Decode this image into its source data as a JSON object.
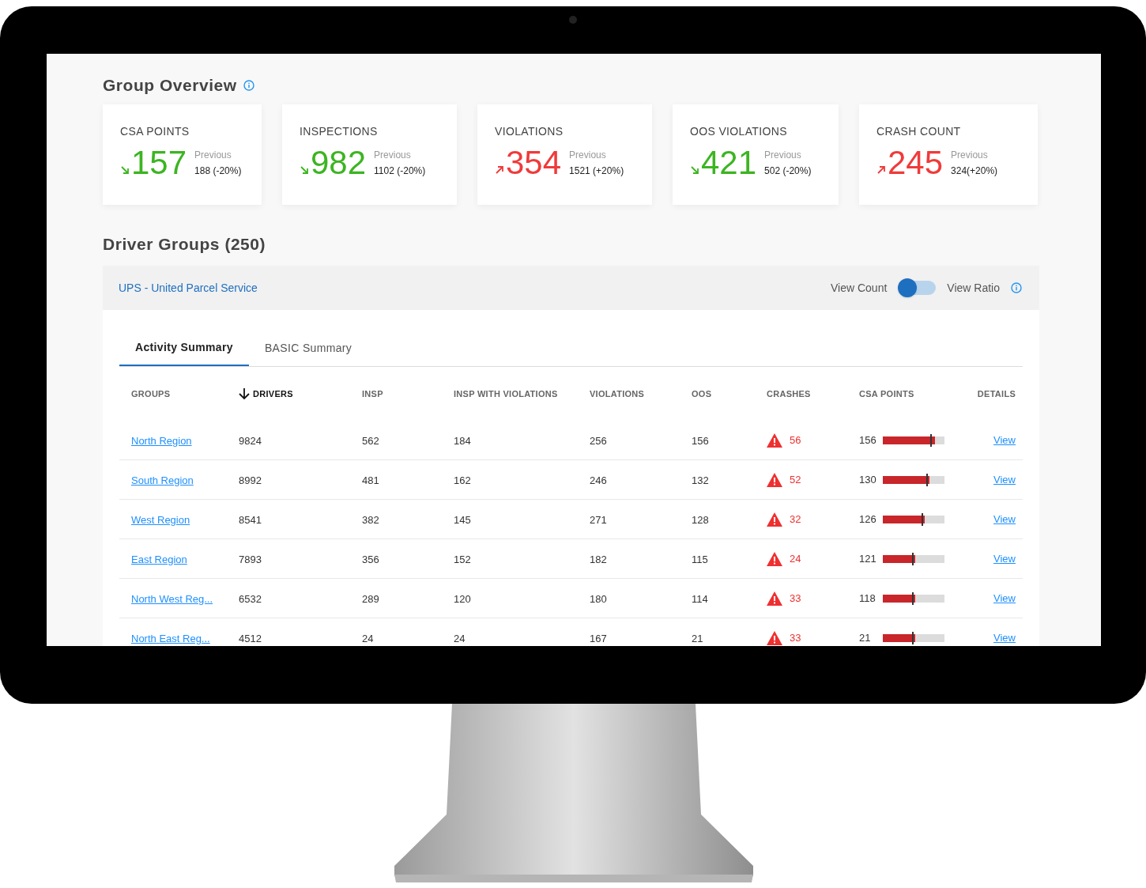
{
  "overview": {
    "title": "Group Overview",
    "cards": [
      {
        "label": "CSA POINTS",
        "value": "157",
        "increase": false,
        "previous_label": "Previous",
        "previous": "188 (-20%)"
      },
      {
        "label": "INSPECTIONS",
        "value": "982",
        "increase": false,
        "previous_label": "Previous",
        "previous": "1102 (-20%)"
      },
      {
        "label": "VIOLATIONS",
        "value": "354",
        "increase": true,
        "previous_label": "Previous",
        "previous": "1521 (+20%)"
      },
      {
        "label": "OOS VIOLATIONS",
        "value": "421",
        "increase": false,
        "previous_label": "Previous",
        "previous": "502 (-20%)"
      },
      {
        "label": "CRASH COUNT",
        "value": "245",
        "increase": true,
        "previous_label": "Previous",
        "previous": "324(+20%)"
      }
    ]
  },
  "driver_groups": {
    "title": "Driver Groups (250)",
    "company": "UPS - United Parcel Service",
    "toggle": {
      "left_label": "View Count",
      "right_label": "View Ratio",
      "on": false
    },
    "tabs": [
      {
        "label": "Activity Summary",
        "selected": true
      },
      {
        "label": "BASIC Summary",
        "selected": false
      }
    ],
    "table": {
      "columns": [
        {
          "label": "GROUPS",
          "sorted": false
        },
        {
          "label": "DRIVERS",
          "sorted": true
        },
        {
          "label": "INSP",
          "sorted": false
        },
        {
          "label": "INSP WITH VIOLATIONS",
          "sorted": false
        },
        {
          "label": "VIOLATIONS",
          "sorted": false
        },
        {
          "label": "OOS",
          "sorted": false
        },
        {
          "label": "CRASHES",
          "sorted": false
        },
        {
          "label": "CSA POINTS",
          "sorted": false
        },
        {
          "label": "DETAILS",
          "sorted": false
        }
      ],
      "rows": [
        {
          "group": "North Region",
          "drivers": "9824",
          "insp": "562",
          "insp_with_violations": "184",
          "violations": "256",
          "oos": "156",
          "crashes": "56",
          "csa_points": "156",
          "level": 0.84,
          "details": "View"
        },
        {
          "group": "South Region",
          "drivers": "8992",
          "insp": "481",
          "insp_with_violations": "162",
          "violations": "246",
          "oos": "132",
          "crashes": "52",
          "csa_points": "130",
          "level": 0.76,
          "details": "View"
        },
        {
          "group": "West Region",
          "drivers": "8541",
          "insp": "382",
          "insp_with_violations": "145",
          "violations": "271",
          "oos": "128",
          "crashes": "32",
          "csa_points": "126",
          "level": 0.68,
          "details": "View"
        },
        {
          "group": "East Region",
          "drivers": "7893",
          "insp": "356",
          "insp_with_violations": "152",
          "violations": "182",
          "oos": "115",
          "crashes": "24",
          "csa_points": "121",
          "level": 0.52,
          "details": "View"
        },
        {
          "group": "North West Reg...",
          "drivers": "6532",
          "insp": "289",
          "insp_with_violations": "120",
          "violations": "180",
          "oos": "114",
          "crashes": "33",
          "csa_points": "118",
          "level": 0.52,
          "details": "View"
        },
        {
          "group": "North East Reg...",
          "drivers": "4512",
          "insp": "24",
          "insp_with_violations": "24",
          "violations": "167",
          "oos": "21",
          "crashes": "33",
          "csa_points": "21",
          "level": 0.52,
          "details": "View"
        }
      ]
    }
  }
}
